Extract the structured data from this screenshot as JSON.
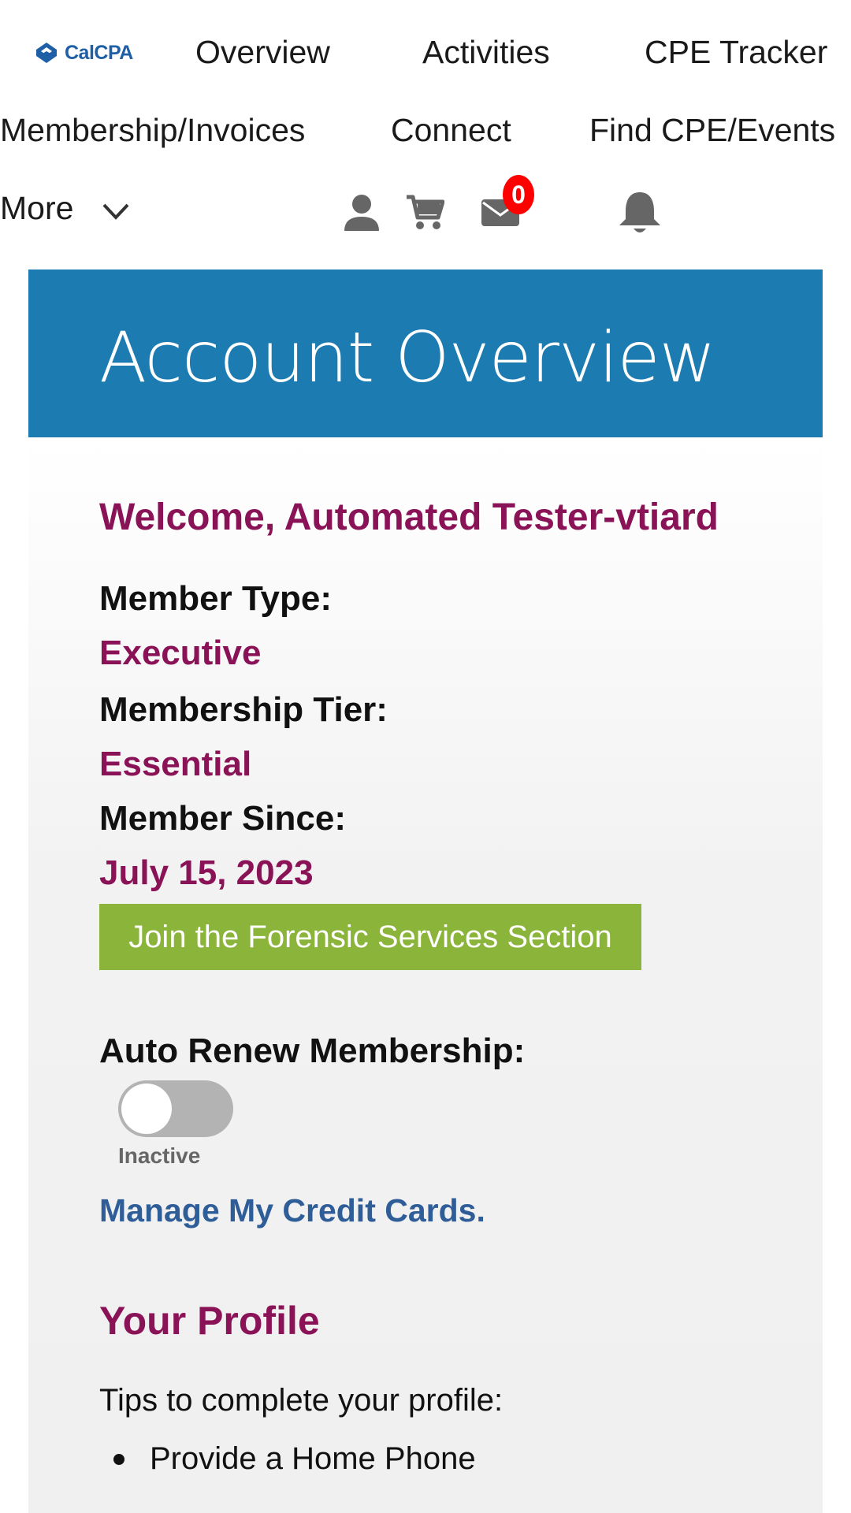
{
  "nav": {
    "logo_text": "CalCPA",
    "items": [
      "Overview",
      "Activities",
      "CPE Tracker",
      "Membership/Invoices",
      "Connect",
      "Find CPE/Events"
    ],
    "more_label": "More",
    "message_count": "0",
    "icons": [
      "user-icon",
      "cart-icon",
      "mail-icon",
      "bell-icon",
      "chevron-down-icon"
    ]
  },
  "banner": {
    "title": "Account Overview",
    "color": "#1c7bb0"
  },
  "account": {
    "welcome": "Welcome, Automated Tester-vtiard",
    "member_type_label": "Member Type:",
    "member_type_value": "Executive",
    "tier_label": "Membership Tier:",
    "tier_value": "Essential",
    "since_label": "Member Since:",
    "since_value": "July 15, 2023",
    "join_button": "Join the Forensic Services Section",
    "auto_renew_label": "Auto Renew Membership:",
    "auto_renew_status": "Inactive",
    "auto_renew_on": false,
    "credit_cards_link": "Manage My Credit Cards."
  },
  "profile": {
    "heading": "Your Profile",
    "tips_intro": "Tips to complete your profile:",
    "tips": [
      "Provide a Home Phone"
    ]
  },
  "colors": {
    "accent": "#8a1256",
    "button": "#8ab43a",
    "link": "#2e5d98",
    "badge": "#ff0000"
  }
}
